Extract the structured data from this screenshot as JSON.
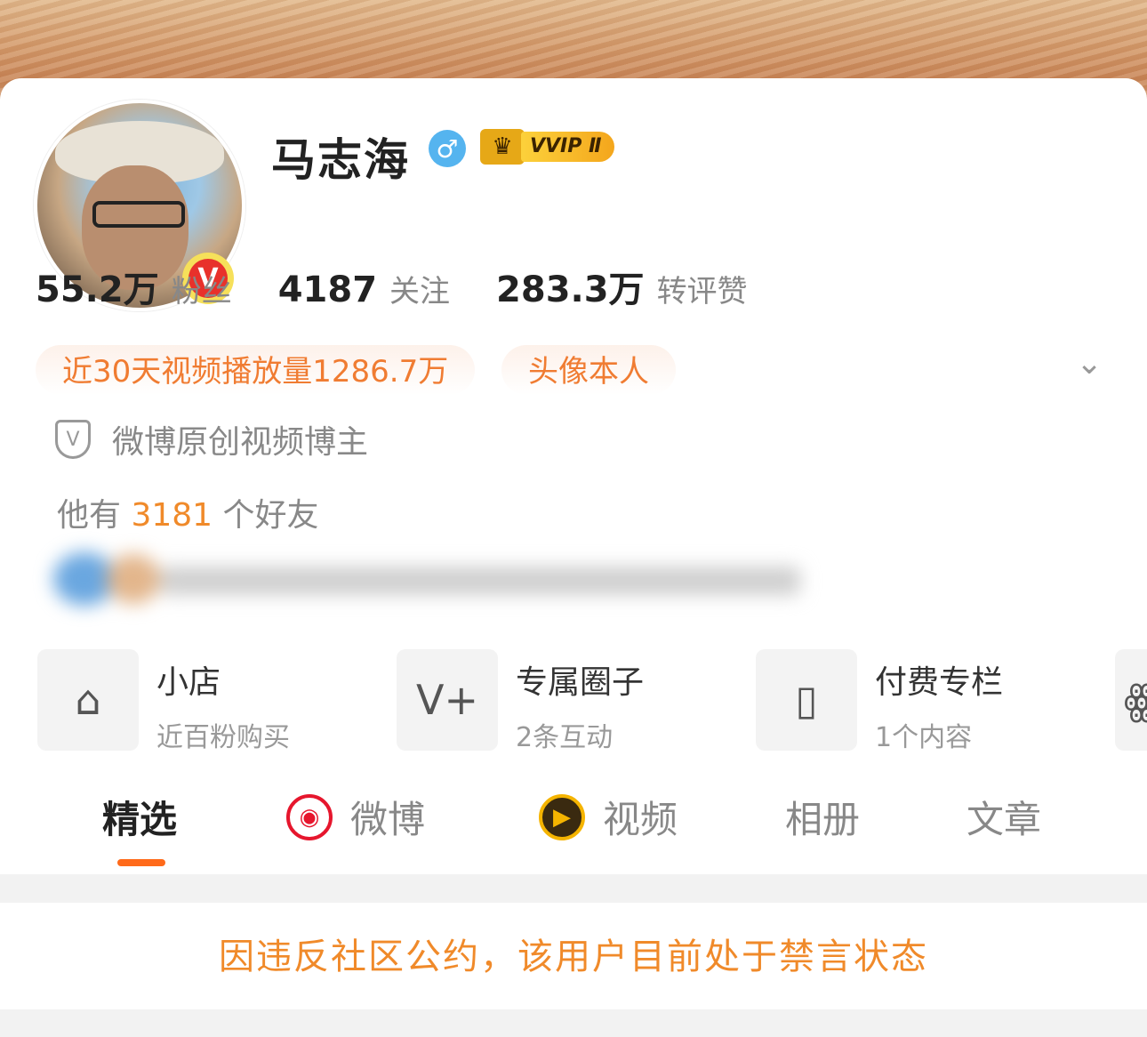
{
  "profile": {
    "name": "马志海",
    "gender_symbol": "♂",
    "verified_badge": "V",
    "vip_label": "VVIP Ⅱ",
    "crown_symbol": "♛"
  },
  "stats": [
    {
      "num": "55.2万",
      "label": "粉丝"
    },
    {
      "num": "4187",
      "label": "关注"
    },
    {
      "num": "283.3万",
      "label": "转评赞"
    }
  ],
  "tags": {
    "video_views": "近30天视频播放量1286.7万",
    "avatar_self": "头像本人",
    "expand_symbol": "⌄"
  },
  "verification": {
    "shield_symbol": "V",
    "text": "微博原创视频博主"
  },
  "friends": {
    "prefix": "他有",
    "count": "3181",
    "suffix": "个好友"
  },
  "services": [
    {
      "icon": "shop-icon",
      "glyph": "⌂",
      "title": "小店",
      "subtitle": "近百粉购买"
    },
    {
      "icon": "circle-icon",
      "glyph": "V+",
      "title": "专属圈子",
      "subtitle": "2条互动"
    },
    {
      "icon": "column-icon",
      "glyph": "▯",
      "title": "付费专栏",
      "subtitle": "1个内容"
    },
    {
      "icon": "more-icon",
      "glyph": "ꙮ"
    }
  ],
  "tabs": [
    {
      "label": "精选",
      "active": true
    },
    {
      "label": "微博",
      "icon": "weibo-icon",
      "glyph": "◉"
    },
    {
      "label": "视频",
      "icon": "video-icon",
      "glyph": "▶"
    },
    {
      "label": "相册"
    },
    {
      "label": "文章"
    }
  ],
  "notice": "因违反社区公约，该用户目前处于禁言状态",
  "colors": {
    "accent_orange": "#f08a2a",
    "tab_underline": "#ff6a1a",
    "gender_blue": "#55b4ef",
    "verified_red": "#e8312b"
  }
}
